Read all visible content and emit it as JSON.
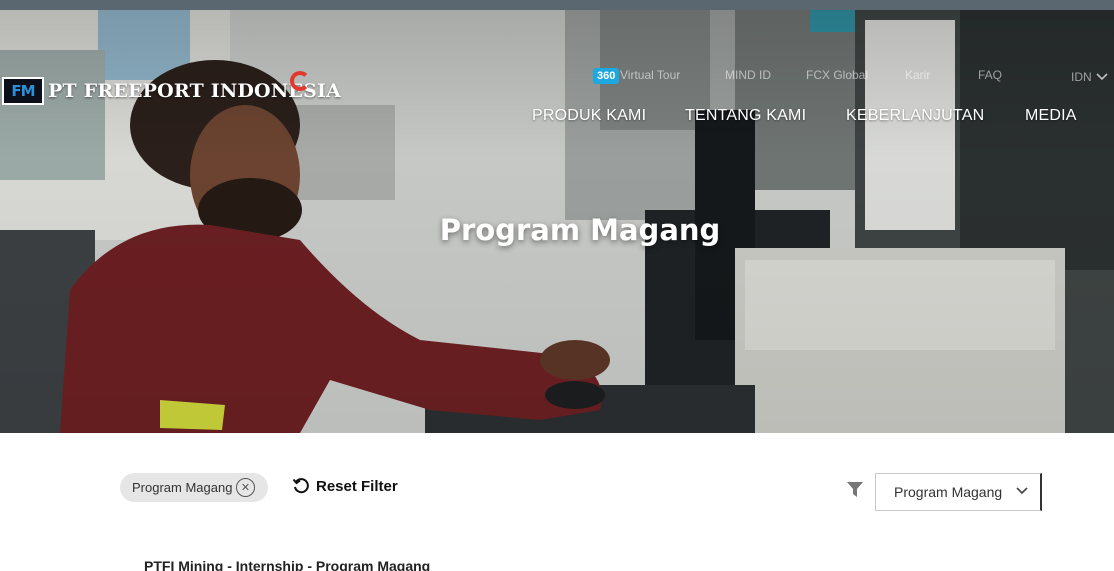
{
  "header": {
    "brand_name": "PT FREEPORT INDONESIA",
    "brand_mark": "FM",
    "utility_links": {
      "badge": "360",
      "virtual_tour": "Virtual Tour",
      "mind_id": "MIND ID",
      "fcx_global": "FCX Global",
      "karir": "Karir",
      "faq": "FAQ",
      "language": "IDN"
    },
    "nav": {
      "produk": "PRODUK KAMI",
      "tentang": "TENTANG KAMI",
      "keberlanjutan": "KEBERLANJUTAN",
      "media": "MEDIA"
    }
  },
  "hero": {
    "title": "Program Magang"
  },
  "filters": {
    "active_chip": "Program Magang",
    "reset_label": "Reset Filter",
    "category_select": "Program Magang"
  },
  "results": [
    {
      "title": "PTFI Mining - Internship - Program Magang"
    }
  ],
  "colors": {
    "badge": "#1ea8e0",
    "brand_ring": "#e03a2f",
    "topbar": "#5a6670"
  },
  "icons": [
    "chevron-down-icon",
    "close-circle-icon",
    "reset-icon",
    "filter-icon"
  ]
}
